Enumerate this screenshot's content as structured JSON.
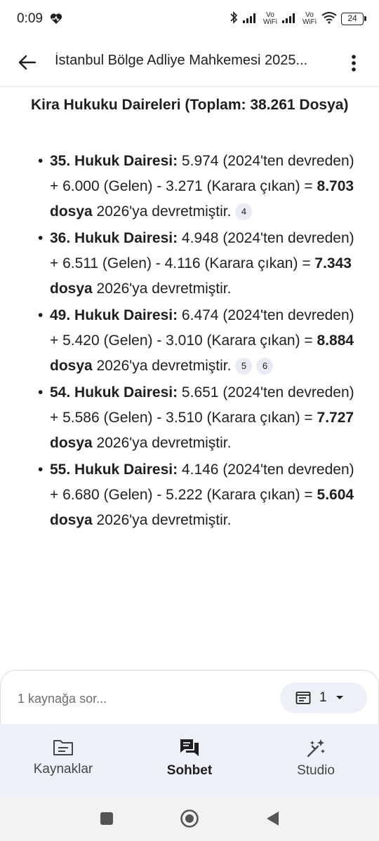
{
  "status_bar": {
    "time": "0:09",
    "network_1": "Vo WiFi",
    "network_2": "Vo WiFi",
    "battery": "24",
    "icons": [
      "heart-rate-icon",
      "bluetooth-icon",
      "signal-icon",
      "signal-icon",
      "wifi-icon",
      "battery-icon"
    ]
  },
  "app_bar": {
    "title": "İstanbul Bölge Adliye Mahkemesi 2025...",
    "back_icon": "arrow-back-icon",
    "more_icon": "more-vert-icon"
  },
  "content": {
    "section_title": "Kira Hukuku Daireleri (Toplam: 38.261 Dosya)",
    "items": [
      {
        "name": "35. Hukuk Dairesi:",
        "text_before": " 5.974 (2024'ten devreden) + 6.000 (Gelen) - 3.271 (Karara çıkan) = ",
        "total": "8.703 dosya",
        "text_after": " 2026'ya devretmiştir.",
        "citations": [
          "4"
        ]
      },
      {
        "name": "36. Hukuk Dairesi:",
        "text_before": " 4.948 (2024'ten devreden) + 6.511 (Gelen) - 4.116 (Karara çıkan) = ",
        "total": "7.343 dosya",
        "text_after": " 2026'ya devretmiştir.",
        "citations": []
      },
      {
        "name": "49. Hukuk Dairesi:",
        "text_before": " 6.474 (2024'ten devreden) + 5.420 (Gelen) - 3.010 (Karara çıkan) = ",
        "total": "8.884 dosya",
        "text_after": " 2026'ya devretmiştir.",
        "citations": [
          "5",
          "6"
        ]
      },
      {
        "name": "54. Hukuk Dairesi:",
        "text_before": " 5.651 (2024'ten devreden) + 5.586 (Gelen) - 3.510 (Karara çıkan) = ",
        "total": "7.727 dosya",
        "text_after": " 2026'ya devretmiştir.",
        "citations": []
      },
      {
        "name": "55. Hukuk Dairesi:",
        "text_before": " 4.146 (2024'ten devreden) + 6.680 (Gelen) - 5.222 (Karara çıkan) = ",
        "total": "5.604 dosya",
        "text_after": " 2026'ya devretmiştir.",
        "citations": []
      }
    ]
  },
  "input": {
    "placeholder": "1 kaynağa sor...",
    "source_count": "1"
  },
  "bottom_nav": {
    "items": [
      {
        "label": "Kaynaklar",
        "icon": "sources-icon",
        "active": false
      },
      {
        "label": "Sohbet",
        "icon": "chat-icon",
        "active": true
      },
      {
        "label": "Studio",
        "icon": "magic-wand-icon",
        "active": false
      }
    ]
  },
  "colors": {
    "nav_background": "#eef1fa",
    "chip_background": "#edf0f7",
    "citation_background": "#e8ebf5",
    "text": "#1f1f1f"
  }
}
